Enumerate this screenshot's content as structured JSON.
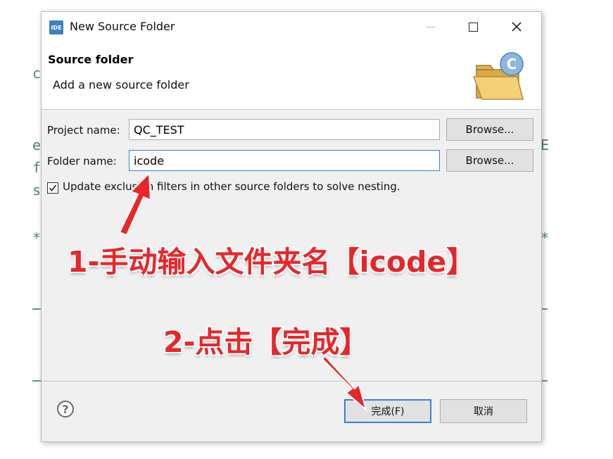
{
  "window": {
    "title": "New Source Folder",
    "app_icon_text": "IDE"
  },
  "header": {
    "title": "Source folder",
    "description": "Add a new source folder",
    "icon_letter": "C"
  },
  "form": {
    "project_label": "Project name:",
    "project_value": "QC_TEST",
    "project_browse": "Browse...",
    "folder_label": "Folder name:",
    "folder_value": "icode",
    "folder_browse": "Browse...",
    "checkbox_label": "Update exclusion filters in other source folders to solve nesting.",
    "checkbox_checked": true
  },
  "footer": {
    "help_symbol": "?",
    "finish_label": "完成(F)",
    "cancel_label": "取消"
  },
  "annotations": {
    "step1": "1-手动输入文件夹名【icode】",
    "step2": "2-点击【完成】",
    "color": "#e8262a"
  },
  "background": {
    "glyphs": [
      "c",
      "e",
      "f",
      "s",
      "*",
      "E",
      "*"
    ]
  },
  "colors": {
    "focus_border": "#3c7fd0",
    "dialog_bg": "#f0f0f0"
  }
}
